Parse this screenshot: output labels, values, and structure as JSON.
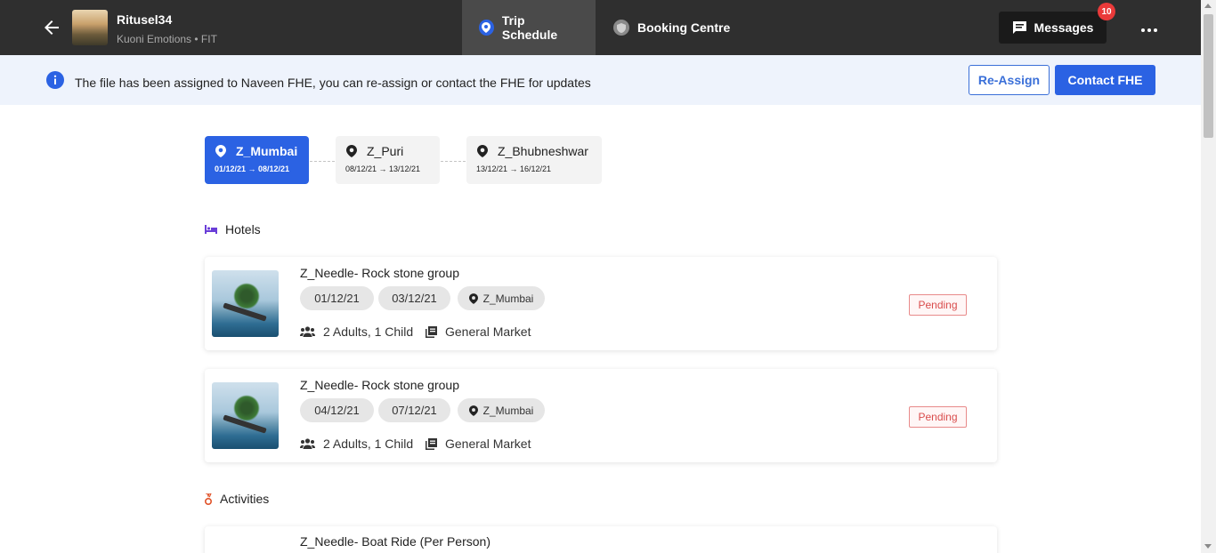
{
  "header": {
    "file_title": "Ritusel34",
    "file_subtitle": "Kuoni Emotions • FIT",
    "tabs": [
      {
        "label": "Trip Schedule",
        "active": true
      },
      {
        "label": "Booking Centre",
        "active": false
      }
    ],
    "messages_label": "Messages",
    "messages_count": "10"
  },
  "banner": {
    "text": "The file has been assigned to Naveen FHE, you can re-assign or contact the FHE for updates",
    "reassign_label": "Re-Assign",
    "contact_label": "Contact FHE"
  },
  "destinations": [
    {
      "name": "Z_Mumbai",
      "dates": "01/12/21 → 08/12/21",
      "active": true
    },
    {
      "name": "Z_Puri",
      "dates": "08/12/21 → 13/12/21",
      "active": false
    },
    {
      "name": "Z_Bhubneshwar",
      "dates": "13/12/21 → 16/12/21",
      "active": false
    }
  ],
  "sections": {
    "hotels": "Hotels",
    "activities": "Activities"
  },
  "hotels": [
    {
      "name": "Z_Needle- Rock stone group",
      "check_in": "01/12/21",
      "check_out": "03/12/21",
      "location": "Z_Mumbai",
      "guests": "2 Adults, 1 Child",
      "market": "General Market",
      "status": "Pending"
    },
    {
      "name": "Z_Needle- Rock stone group",
      "check_in": "04/12/21",
      "check_out": "07/12/21",
      "location": "Z_Mumbai",
      "guests": "2 Adults, 1 Child",
      "market": "General Market",
      "status": "Pending"
    }
  ],
  "activities": [
    {
      "name": "Z_Needle- Boat Ride (Per Person)"
    }
  ],
  "colors": {
    "topbar": "#2f2f2f",
    "primary": "#2b62e3",
    "banner_bg": "#eef3fc",
    "pending": "#d94c4c"
  },
  "icons": [
    "back-arrow-icon",
    "location-pin-icon",
    "shield-icon",
    "chat-icon",
    "more-dots-icon",
    "info-icon",
    "bed-icon",
    "medal-icon",
    "people-icon",
    "document-icon"
  ]
}
